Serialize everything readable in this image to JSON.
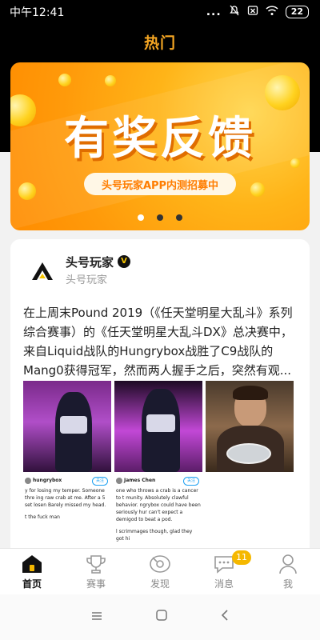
{
  "status_bar": {
    "time": "中午12:41",
    "signal": "...",
    "battery": "22"
  },
  "header": {
    "title": "热门"
  },
  "banner": {
    "title": "有奖反馈",
    "subtitle": "头号玩家APP内测招募中",
    "page_count": 3,
    "active_page": 1
  },
  "post": {
    "author": "头号玩家",
    "author_sub": "头号玩家",
    "verified_mark": "V",
    "text": "在上周末Pound 2019（《任天堂明星大乱斗》系列综合赛事）的《任天堂明星大乱斗DX》总决赛中，来自Liquid战队的Hungrybox战胜了C9战队的Mang0获得冠军，然而两人握手之后，突然有观...",
    "images": [
      {
        "handle": "hungrybox",
        "follow": "关注",
        "text": "y for losing my temper. Someone thre ing raw crab at me. After a 5 set losen Barely missed my head.",
        "text2": "t the fuck man"
      },
      {
        "handle": "James Chen",
        "follow": "关注",
        "text": "one who throws a crab is a cancer to t munity. Absolutely clawful behavior. ngrybox could have been seriously hur can't expect a demigod to beat a pod.",
        "text2": "l scrimmages though, glad they got hi"
      },
      {
        "handle": "",
        "follow": "",
        "text": "",
        "text2": ""
      }
    ]
  },
  "tabs": [
    {
      "label": "首页",
      "icon": "home-icon",
      "active": true
    },
    {
      "label": "赛事",
      "icon": "trophy-icon",
      "active": false
    },
    {
      "label": "发现",
      "icon": "compass-icon",
      "active": false
    },
    {
      "label": "消息",
      "icon": "message-icon",
      "active": false,
      "badge": "11"
    },
    {
      "label": "我",
      "icon": "profile-icon",
      "active": false
    }
  ],
  "colors": {
    "accent": "#f5a623",
    "badge": "#f5b800",
    "banner": "#ffb418"
  }
}
